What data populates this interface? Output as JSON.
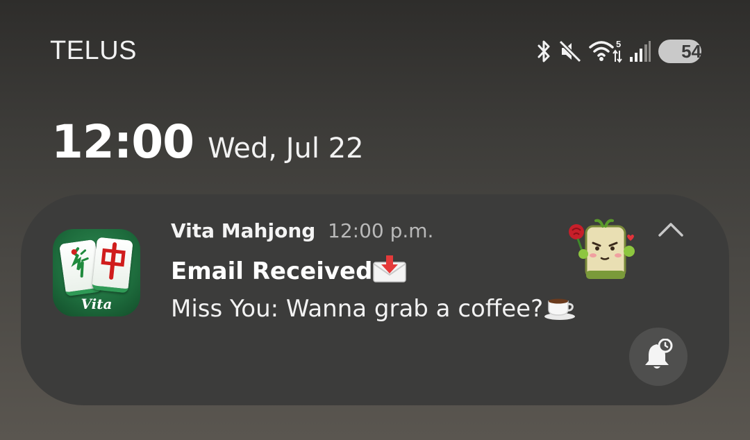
{
  "status_bar": {
    "carrier": "TELUS",
    "icons": [
      "bluetooth-icon",
      "mute-icon",
      "wifi-icon",
      "signal-icon"
    ],
    "wifi_badge": "5",
    "battery_level": "54",
    "battery_fraction": 0.54
  },
  "lock_screen": {
    "time": "12:00",
    "date": "Wed, Jul 22"
  },
  "notification": {
    "app_name": "Vita Mahjong",
    "time": "12:00 p.m.",
    "app_icon_label": "Vita",
    "title": "Email Received",
    "body": "Miss You: Wanna grab a coffee?",
    "icons": [
      "envelope-arrow-icon",
      "coffee-cup-icon",
      "mahjong-tile-sticker",
      "collapse-chevron-icon",
      "snooze-bell-icon"
    ],
    "colors": {
      "card": "#3c3c3b",
      "app_icon_green": "#1d6b3c",
      "snooze_button": "#4f4f4e"
    }
  }
}
